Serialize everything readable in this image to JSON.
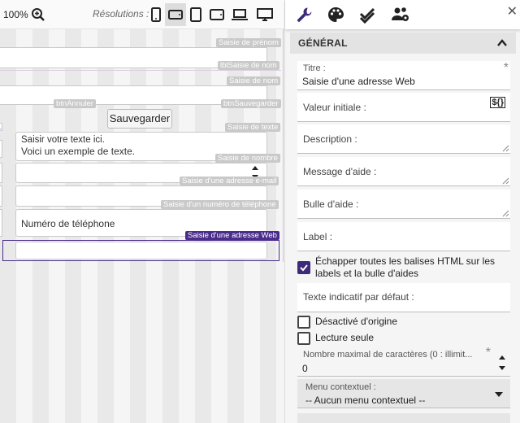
{
  "toolbar": {
    "zoom": "100%",
    "resolutions_label": "Résolutions :",
    "devices": [
      "phone-portrait",
      "phone-landscape",
      "tablet-portrait",
      "tablet-landscape",
      "laptop",
      "desktop"
    ],
    "active_device": "phone-landscape"
  },
  "canvas": {
    "tags": {
      "saisie_prenom": "Saisie de prénom",
      "lbl_saisie_nom": "lblSaisie de nom",
      "saisie_nom": "Saisie de nom",
      "btn_annuler": "btnAnnuler",
      "btn_sauvegarder": "btnSauvegarder",
      "saisie_texte": "Saisie de texte",
      "saisie_nombre": "Saisie de nombre",
      "saisie_email": "Saisie d'une adresse e-mail",
      "saisie_telephone": "Saisie d'un numéro de téléphone",
      "saisie_web": "Saisie d'une adresse Web"
    },
    "save_button": "Sauvegarder",
    "textarea_placeholder": "Saisir votre texte ici.",
    "textarea_example": "Voici un exemple de texte.",
    "phone_placeholder": "Numéro de téléphone"
  },
  "panel": {
    "tabs": [
      "wrench",
      "palette",
      "checkmark",
      "users"
    ],
    "section_title": "GÉNÉRAL",
    "title_label": "Titre :",
    "title_value": "Saisie d'une adresse Web",
    "initial_value_label": "Valeur initiale :",
    "variable_badge": "${}",
    "description_label": "Description :",
    "help_message_label": "Message d'aide :",
    "help_bubble_label": "Bulle d'aide :",
    "label_label": "Label :",
    "escape_html_label": "Échapper toutes les balises HTML sur les labels et la bulle d'aides",
    "escape_html_checked": true,
    "placeholder_label": "Texte indicatif par défaut :",
    "disabled_label": "Désactivé d'origine",
    "disabled_checked": false,
    "readonly_label": "Lecture seule",
    "readonly_checked": false,
    "maxchars_label": "Nombre maximal de caractères (0 : illimit...",
    "maxchars_value": "0",
    "context_menu_label": "Menu contextuel :",
    "context_menu_value": "-- Aucun menu contextuel --"
  },
  "colors": {
    "accent": "#3d2a7a",
    "selection": "#4a2c8a",
    "tag_gray": "#c9c9c9"
  }
}
